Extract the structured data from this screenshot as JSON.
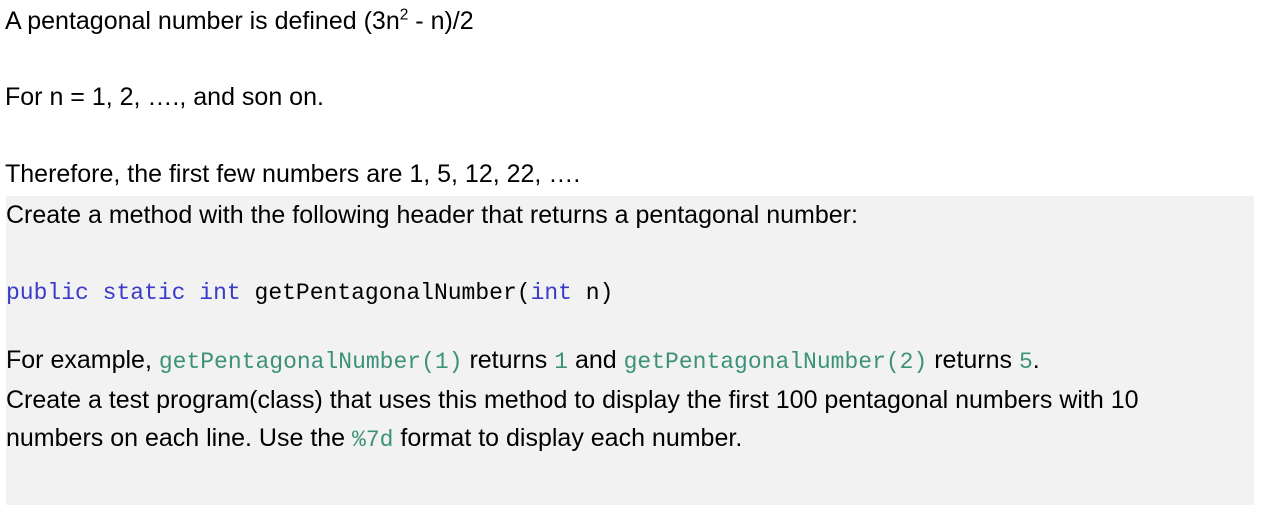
{
  "document": {
    "intro": {
      "line1_pre": "A pentagonal number is defined (3n",
      "line1_sup": "2",
      "line1_post": " - n)/2",
      "line2": "For n = 1, 2, …., and son on.",
      "line3": "Therefore, the first few numbers are 1, 5, 12, 22, …."
    },
    "panel": {
      "background_color": "#f2f2f2",
      "intro_text": "Create a method with the following header that returns a pentagonal number:",
      "signature": {
        "kw_public": "public",
        "space1": " ",
        "kw_static": "static",
        "space2": " ",
        "kw_int": "int",
        "space3": " ",
        "method_name": "getPentagonalNumber(",
        "kw_param_type": "int",
        "param_tail": " n)"
      },
      "example": {
        "prefix": "For example, ",
        "call1": "getPentagonalNumber(1)",
        "mid1": " returns ",
        "result1": "1",
        "mid2": " and ",
        "call2": "getPentagonalNumber(2)",
        "mid3": " returns ",
        "result2": "5",
        "suffix": "."
      },
      "task_line1": "Create a test program(class) that uses this method to display the first 100 pentagonal numbers with 10",
      "task_line2_pre": "numbers on each line. Use the ",
      "task_format": "%7d",
      "task_line2_post": " format to display each number."
    },
    "colors": {
      "keyword": "#3b3bc9",
      "code": "#3c9279",
      "text": "#000000",
      "panel": "#f2f2f2",
      "page": "#ffffff"
    }
  }
}
